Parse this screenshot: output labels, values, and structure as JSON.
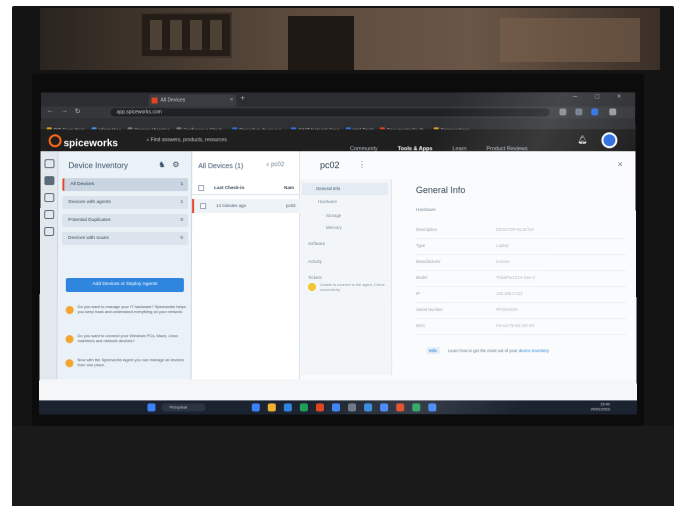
{
  "browser": {
    "tab_title": "All Devices",
    "tab_close": "×",
    "new_tab": "+",
    "window_controls": "– □ ×",
    "nav": [
      "←",
      "→",
      "↻"
    ],
    "url": "app.spiceworks.com",
    "bookmarks": [
      {
        "label": "RIT Consultoria",
        "color": "#e0a020"
      },
      {
        "label": "Informática",
        "color": "#4a8fe0"
      },
      {
        "label": "Storage Migration",
        "color": "#7a7a7a"
      },
      {
        "label": "Configurar o Site la...",
        "color": "#7a7a7a"
      },
      {
        "label": "Procedure de save p...",
        "color": "#2d6fe0"
      },
      {
        "label": "SWIT Network Scan",
        "color": "#2d6fe0"
      },
      {
        "label": "Intel Pools",
        "color": "#2d6fe0"
      },
      {
        "label": "Documentação de...",
        "color": "#e0431d"
      },
      {
        "label": "Fornecedores",
        "color": "#e0a020"
      }
    ]
  },
  "header": {
    "logo": "spiceworks",
    "search_placeholder": "Find answers, products, resources",
    "nav": [
      {
        "label": "Community",
        "active": false
      },
      {
        "label": "Tools & Apps",
        "active": true
      },
      {
        "label": "Learn",
        "active": false
      },
      {
        "label": "Product Reviews",
        "active": false
      }
    ]
  },
  "inventory": {
    "title": "Device Inventory",
    "items": [
      {
        "label": "All Devices",
        "count": "1",
        "selected": true
      },
      {
        "label": "Devices with agents",
        "count": "1",
        "selected": false
      },
      {
        "label": "Potential Duplicates",
        "count": "0",
        "selected": false
      },
      {
        "label": "Devices with scans",
        "count": "0",
        "selected": false
      }
    ],
    "button": "Add Devices or Deploy Agents",
    "tips": [
      "Do you want to manage your IT hardware? Spiceworks helps you keep track and understand everything on your network.",
      "Do you want to connect your Windows PCs, Macs, Linux machines and network devices?",
      "Now with the Spiceworks Agent you can manage all devices from one place."
    ]
  },
  "devices": {
    "title": "All Devices (1)",
    "search_text": "pc02",
    "columns": [
      "Last Check-in",
      "Nam"
    ],
    "rows": [
      {
        "check_in": "14 minutes ago",
        "name": "pc02"
      }
    ]
  },
  "detail": {
    "title": "pc02",
    "menu": "⋮",
    "close": "×",
    "subnav": [
      {
        "label": "General Info",
        "selected": true
      },
      {
        "label": "Hardware",
        "selected": false
      },
      {
        "label": "Storage",
        "selected": false
      },
      {
        "label": "Memory",
        "selected": false
      },
      {
        "label": "Software",
        "selected": false
      },
      {
        "label": "Activity",
        "selected": false
      },
      {
        "label": "Tickets",
        "selected": false
      }
    ],
    "warning": "Unable to connect to the agent. Check connectivity.",
    "general_title": "General Info",
    "general_subtitle": "Hardware",
    "fields": [
      {
        "label": "Description",
        "value": "DESKTOP-6L1K7UI"
      },
      {
        "label": "Type",
        "value": "Laptop"
      },
      {
        "label": "Manufacturer",
        "value": "Lenovo"
      },
      {
        "label": "Model",
        "value": "ThinkPad E14 Gen 2"
      },
      {
        "label": "IP",
        "value": "192.168.0.112"
      },
      {
        "label": "Serial Number",
        "value": "PF2XXXXX"
      },
      {
        "label": "MAC",
        "value": "F4-A4-75-XX-XX-XX"
      }
    ],
    "info_badge": "Info",
    "info_text": "Learn how to get the most out of your ",
    "info_link": "device inventory"
  },
  "taskbar": {
    "search": "Pesquisar",
    "time": "15:40",
    "date": "20/01/2023",
    "icons": [
      "#3b82f6",
      "#f2b130",
      "#2f86de",
      "#1e9e5a",
      "#e0431d",
      "#3b82f6",
      "#6b7280",
      "#2f86de",
      "#3b82f6",
      "#e0431d",
      "#1e9e5a",
      "#3b82f6"
    ]
  }
}
